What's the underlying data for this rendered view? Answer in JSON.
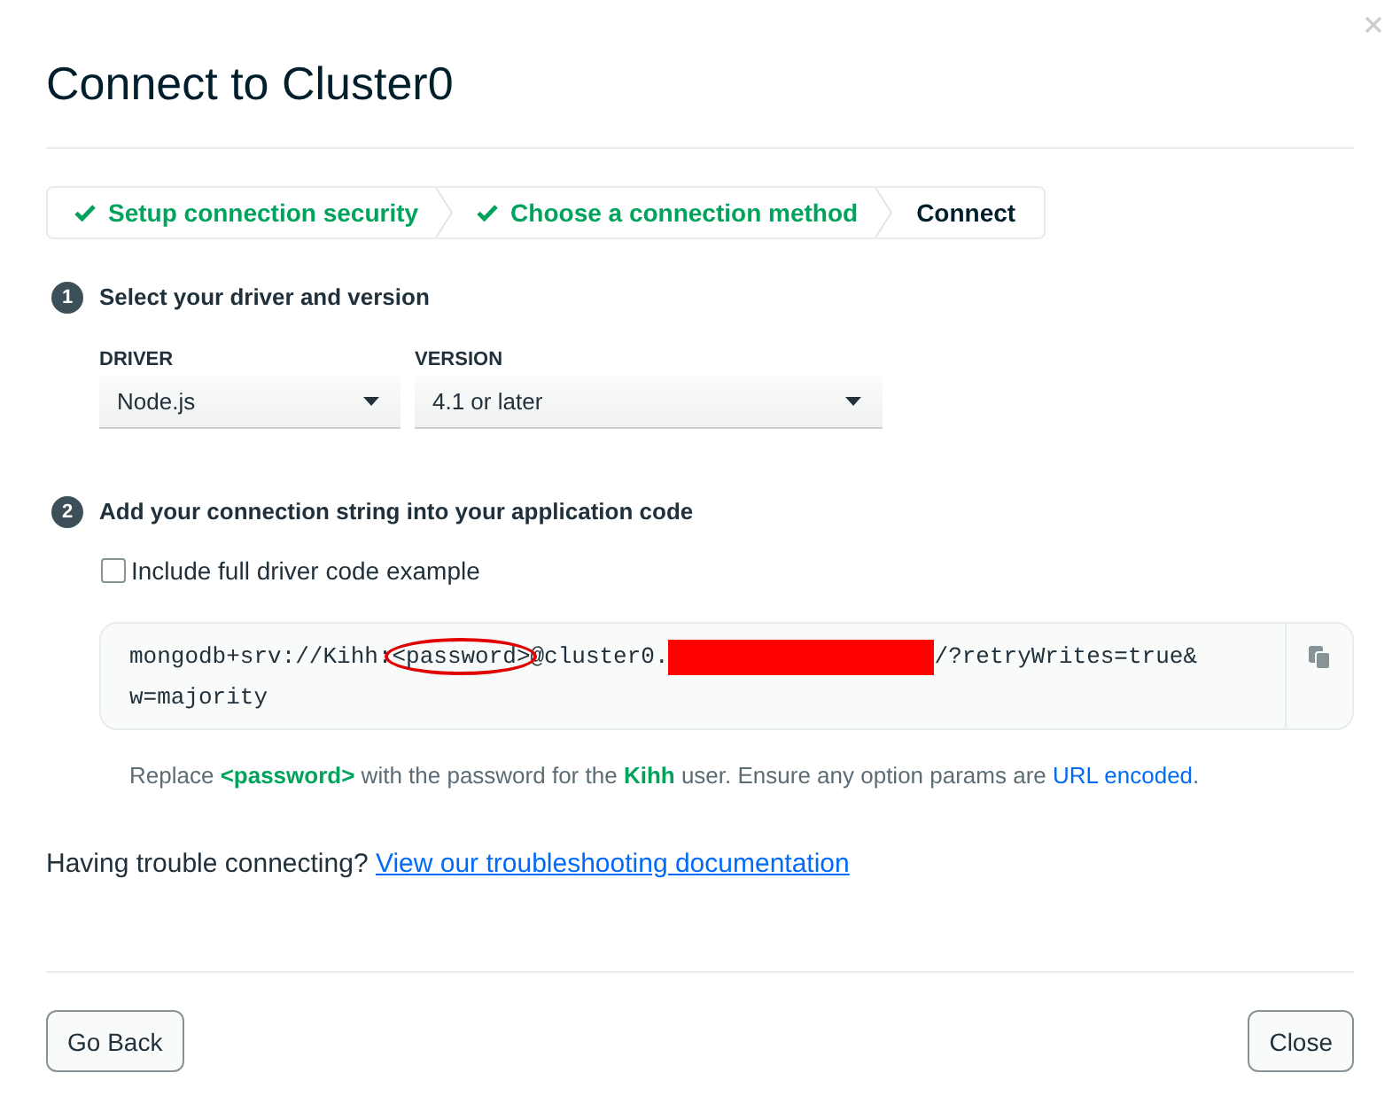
{
  "dialog": {
    "title": "Connect to Cluster0"
  },
  "steps": [
    {
      "label": "Setup connection security",
      "completed": true
    },
    {
      "label": "Choose a connection method",
      "completed": true
    },
    {
      "label": "Connect",
      "completed": false
    }
  ],
  "driver_section": {
    "number": "1",
    "heading": "Select your driver and version",
    "fields": [
      {
        "label": "DRIVER",
        "value": "Node.js"
      },
      {
        "label": "VERSION",
        "value": "4.1 or later"
      }
    ]
  },
  "connection_section": {
    "number": "2",
    "heading": "Add your connection string into your application code",
    "checkbox": {
      "label": "Include full driver code example",
      "checked": false
    },
    "connection_string": {
      "lines": [
        [
          {
            "kind": "text",
            "text": "mongodb+srv://Kihh:"
          },
          {
            "kind": "circled",
            "text": "<password>"
          },
          {
            "kind": "text",
            "text": "@cluster0."
          },
          {
            "kind": "redacted"
          },
          {
            "kind": "text",
            "text": "/?retryWrites=true&"
          }
        ],
        [
          {
            "kind": "text",
            "text": "w=majority"
          }
        ]
      ]
    },
    "hint": {
      "text": "Replace **<password>** with the password for the **Kihh** user. Ensure any option params are",
      "link": "URL encoded",
      "after": "."
    }
  },
  "help": {
    "text": "Having trouble connecting?",
    "link": "View our troubleshooting documentation"
  },
  "buttons": [
    {
      "label": "Go Back"
    },
    {
      "label": "Close"
    }
  ]
}
